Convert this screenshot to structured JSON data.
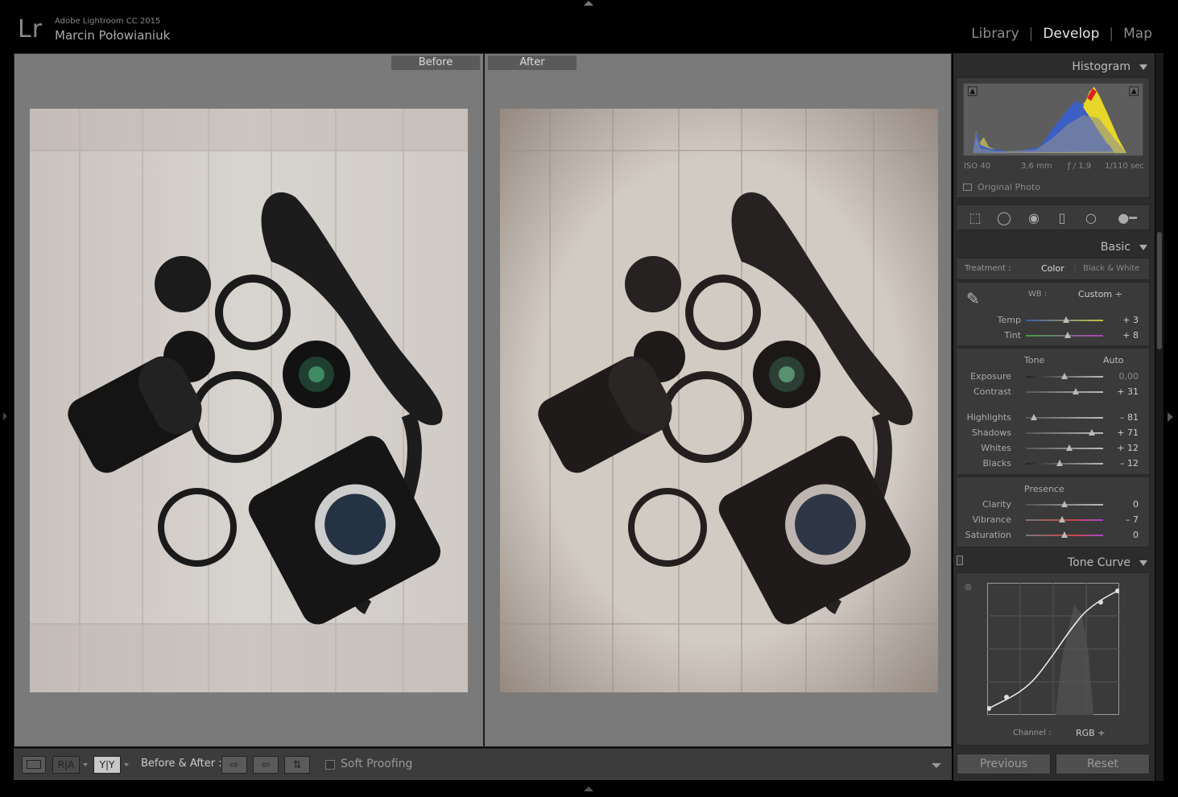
{
  "app": {
    "logo": "Lr",
    "name": "Adobe Lightroom CC 2015",
    "user": "Marcin Połowianiuk"
  },
  "modules": [
    {
      "label": "Library",
      "active": false
    },
    {
      "label": "Develop",
      "active": true
    },
    {
      "label": "Map",
      "active": false
    }
  ],
  "view": {
    "before_label": "Before",
    "after_label": "After"
  },
  "toolbar": {
    "loupe_label": "",
    "ra_label": "R|A",
    "yy_label": "Y|Y",
    "before_after_label": "Before & After :",
    "soft_proofing_label": "Soft Proofing",
    "soft_proofing_checked": false
  },
  "panels": {
    "histogram": {
      "title": "Histogram",
      "iso": "ISO 40",
      "focal": "3,6 mm",
      "aperture": "ƒ / 1,9",
      "shutter": "1/110 sec",
      "original_photo": "Original Photo"
    },
    "basic": {
      "title": "Basic",
      "treatment_label": "Treatment :",
      "treatment_color": "Color",
      "treatment_bw": "Black & White",
      "wb_label": "WB :",
      "wb_value": "Custom ÷",
      "temp": {
        "label": "Temp",
        "value": "+ 3",
        "pos": 0.52
      },
      "tint": {
        "label": "Tint",
        "value": "+ 8",
        "pos": 0.54
      },
      "tone_label": "Tone",
      "auto_label": "Auto",
      "exposure": {
        "label": "Exposure",
        "value": "0,00",
        "pos": 0.5
      },
      "contrast": {
        "label": "Contrast",
        "value": "+ 31",
        "pos": 0.65
      },
      "highlights": {
        "label": "Highlights",
        "value": "– 81",
        "pos": 0.1
      },
      "shadows": {
        "label": "Shadows",
        "value": "+ 71",
        "pos": 0.85
      },
      "whites": {
        "label": "Whites",
        "value": "+ 12",
        "pos": 0.56
      },
      "blacks": {
        "label": "Blacks",
        "value": "– 12",
        "pos": 0.44
      },
      "presence_label": "Presence",
      "clarity": {
        "label": "Clarity",
        "value": "0",
        "pos": 0.5
      },
      "vibrance": {
        "label": "Vibrance",
        "value": "– 7",
        "pos": 0.47
      },
      "saturation": {
        "label": "Saturation",
        "value": "0",
        "pos": 0.5
      }
    },
    "tone_curve": {
      "title": "Tone Curve",
      "channel_label": "Channel :",
      "channel_value": "RGB ÷"
    }
  },
  "buttons": {
    "previous": "Previous",
    "reset": "Reset"
  }
}
